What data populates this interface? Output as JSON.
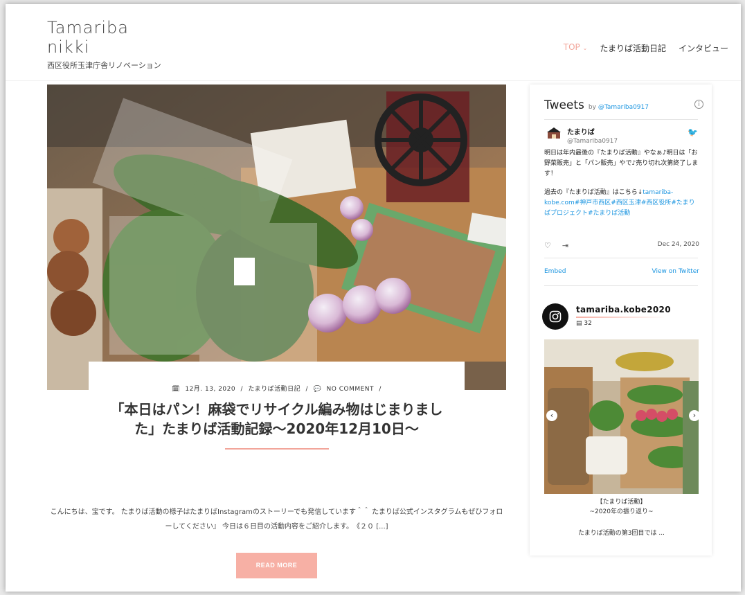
{
  "site": {
    "title_line1": "Tamariba",
    "title_line2": "nikki",
    "tagline": "西区役所玉津庁舎リノベーション"
  },
  "nav": {
    "items": [
      {
        "label": "TOP",
        "active": true
      },
      {
        "label": "たまりば活動日記",
        "active": false
      },
      {
        "label": "インタビュー",
        "active": false
      }
    ]
  },
  "post": {
    "date": "12月. 13, 2020",
    "category": "たまりば活動日記",
    "comments": "NO COMMENT",
    "title": "「本日はパン！麻袋でリサイクル編み物はじまりました」たまりば活動記録～2020年12月10日～",
    "excerpt": "こんにちは、宝です。 たまりば活動の様子はたまりばInstagramのストーリーでも発信しています＾＾ たまりば公式インスタグラムもぜひフォローしてください』 今日は６日目の活動内容をご紹介します。　《２０ [...]",
    "read_more": "READ MORE"
  },
  "twitter": {
    "title": "Tweets",
    "by_prefix": "by",
    "by_handle": "@Tamariba0917",
    "user_name": "たまりば",
    "user_handle": "@Tamariba0917",
    "tweet_text": "明日は年内最後の『たまりば活動』やなぁ♪明日は「お野菜販売」と「パン販売」やで♪売り切れ次第終了します！",
    "tweet_text2_plain": "過去の『たまりば活動』はこちら↓",
    "tweet_text2_link": "tamariba-kobe.com#神戸市西区#西区玉津#西区役所#たまりばプロジェクト#たまりば活動",
    "date": "Dec 24, 2020",
    "embed": "Embed",
    "view_on": "View on Twitter"
  },
  "instagram": {
    "username": "tamariba.kobe2020",
    "post_count": "32",
    "caption_line1": "【たまりば活動】",
    "caption_line2": "~2020年の振り返り~",
    "caption_line3": "たまりば活動の第3回目では ..."
  },
  "colors": {
    "accent": "#f2a59a",
    "button": "#f7b0a5",
    "twitter_link": "#1b95e0"
  }
}
